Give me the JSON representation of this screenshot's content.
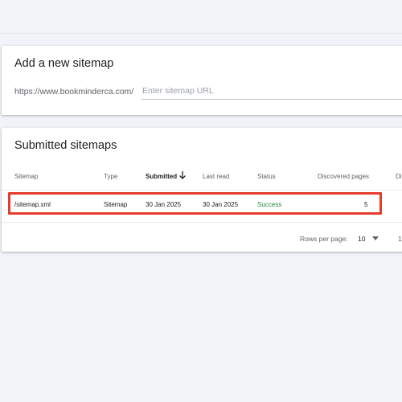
{
  "add_sitemap": {
    "title": "Add a new sitemap",
    "url_prefix": "https://www.bookminderca.com/",
    "input_placeholder": "Enter sitemap URL"
  },
  "submitted_sitemaps": {
    "title": "Submitted sitemaps",
    "columns": {
      "sitemap": "Sitemap",
      "type": "Type",
      "submitted": "Submitted",
      "last_read": "Last read",
      "status": "Status",
      "discovered_pages": "Discovered pages",
      "truncated": "Di"
    },
    "rows": [
      {
        "sitemap": "/sitemap.xml",
        "type": "Sitemap",
        "submitted": "30 Jan 2025",
        "last_read": "30 Jan 2025",
        "status": "Success",
        "discovered_pages": "5"
      }
    ],
    "pagination": {
      "rows_per_page_label": "Rows per page:",
      "rows_per_page_value": "10",
      "range_text": "1"
    }
  },
  "colors": {
    "success": "#1e8e3e",
    "highlight": "#e53b2c",
    "background": "#f1f3f8"
  },
  "icons": {
    "sort": "arrow-down-icon",
    "dropdown": "caret-down-icon"
  }
}
